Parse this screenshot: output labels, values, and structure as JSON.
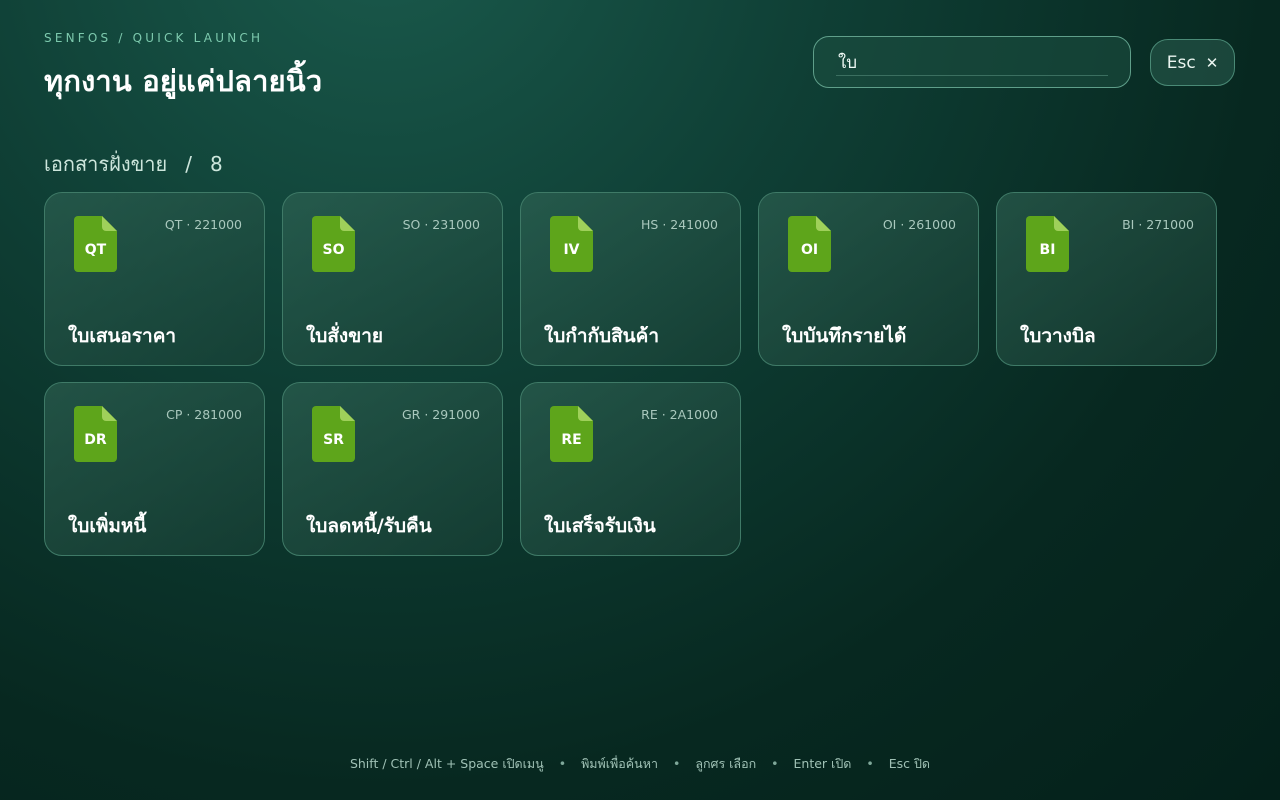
{
  "header": {
    "eyebrow": "SENFOS / QUICK LAUNCH",
    "title": "ทุกงาน อยู่แค่ปลายนิ้ว"
  },
  "search": {
    "value": "ใบ"
  },
  "close_button": {
    "label": "Esc",
    "icon": "close-icon"
  },
  "section": {
    "title": "เอกสารฝั่งขาย",
    "divider": "/",
    "count": "8"
  },
  "colors": {
    "icon_green": "#5ea51b",
    "icon_fold": "#9fd05a",
    "accent": "#7cc9ad"
  },
  "cards": [
    {
      "abbr": "QT",
      "code": "QT · 221000",
      "label": "ใบเสนอราคา"
    },
    {
      "abbr": "SO",
      "code": "SO · 231000",
      "label": "ใบสั่งขาย"
    },
    {
      "abbr": "IV",
      "code": "HS · 241000",
      "label": "ใบกำกับสินค้า"
    },
    {
      "abbr": "OI",
      "code": "OI · 261000",
      "label": "ใบบันทึกรายได้"
    },
    {
      "abbr": "BI",
      "code": "BI · 271000",
      "label": "ใบวางบิล"
    },
    {
      "abbr": "DR",
      "code": "CP · 281000",
      "label": "ใบเพิ่มหนี้"
    },
    {
      "abbr": "SR",
      "code": "GR · 291000",
      "label": "ใบลดหนี้/รับคืน"
    },
    {
      "abbr": "RE",
      "code": "RE · 2A1000",
      "label": "ใบเสร็จรับเงิน"
    }
  ],
  "footer": {
    "hints": [
      "Shift / Ctrl / Alt + Space เปิดเมนู",
      "พิมพ์เพื่อค้นหา",
      "ลูกศร เลือก",
      "Enter เปิด",
      "Esc ปิด"
    ],
    "separator": "•"
  }
}
